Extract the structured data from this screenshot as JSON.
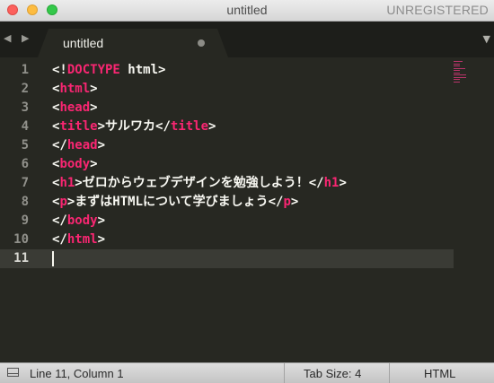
{
  "window": {
    "title": "untitled",
    "license_status": "UNREGISTERED"
  },
  "tabs": [
    {
      "label": "untitled"
    }
  ],
  "editor": {
    "active_line": 11,
    "lines": [
      {
        "number": "1",
        "segments": [
          [
            "p",
            "<!"
          ],
          [
            "t",
            "DOCTYPE"
          ],
          [
            "p",
            " html>"
          ]
        ]
      },
      {
        "number": "2",
        "segments": [
          [
            "p",
            "<"
          ],
          [
            "t",
            "html"
          ],
          [
            "p",
            ">"
          ]
        ]
      },
      {
        "number": "3",
        "segments": [
          [
            "p",
            "<"
          ],
          [
            "t",
            "head"
          ],
          [
            "p",
            ">"
          ]
        ]
      },
      {
        "number": "4",
        "segments": [
          [
            "p",
            "<"
          ],
          [
            "t",
            "title"
          ],
          [
            "p",
            ">サルワカ</"
          ],
          [
            "t",
            "title"
          ],
          [
            "p",
            ">"
          ]
        ]
      },
      {
        "number": "5",
        "segments": [
          [
            "p",
            "</"
          ],
          [
            "t",
            "head"
          ],
          [
            "p",
            ">"
          ]
        ]
      },
      {
        "number": "6",
        "segments": [
          [
            "p",
            "<"
          ],
          [
            "t",
            "body"
          ],
          [
            "p",
            ">"
          ]
        ]
      },
      {
        "number": "7",
        "segments": [
          [
            "p",
            "<"
          ],
          [
            "t",
            "h1"
          ],
          [
            "p",
            ">ゼロからウェブデザインを勉強しよう！</"
          ],
          [
            "t",
            "h1"
          ],
          [
            "p",
            ">"
          ]
        ]
      },
      {
        "number": "8",
        "segments": [
          [
            "p",
            "<"
          ],
          [
            "t",
            "p"
          ],
          [
            "p",
            ">まずはHTMLについて学びましょう</"
          ],
          [
            "t",
            "p"
          ],
          [
            "p",
            ">"
          ]
        ]
      },
      {
        "number": "9",
        "segments": [
          [
            "p",
            "</"
          ],
          [
            "t",
            "body"
          ],
          [
            "p",
            ">"
          ]
        ]
      },
      {
        "number": "10",
        "segments": [
          [
            "p",
            "</"
          ],
          [
            "t",
            "html"
          ],
          [
            "p",
            ">"
          ]
        ]
      },
      {
        "number": "11",
        "segments": []
      }
    ]
  },
  "status": {
    "position": "Line 11, Column 1",
    "tab_size": "Tab Size: 4",
    "syntax": "HTML"
  },
  "colors": {
    "background": "#272822",
    "tag": "#f92672",
    "text": "#f8f8f2"
  }
}
